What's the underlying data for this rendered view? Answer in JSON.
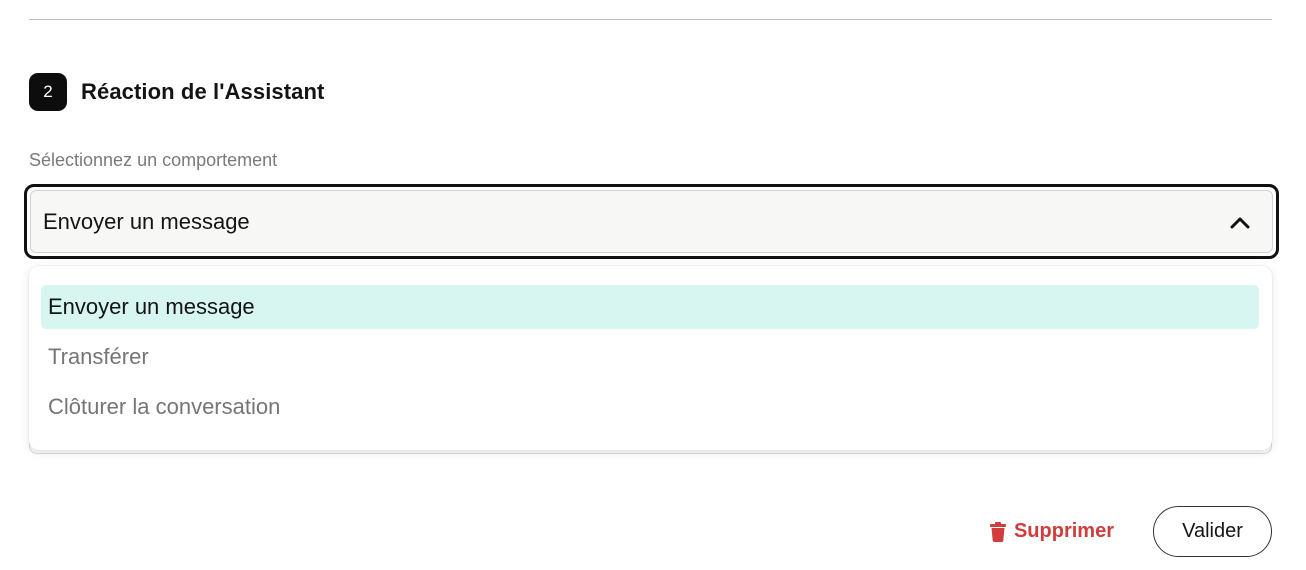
{
  "step": {
    "number": "2",
    "title": "Réaction de l'Assistant"
  },
  "behavior_field": {
    "label": "Sélectionnez un comportement",
    "selected_value": "Envoyer un message",
    "expanded": true,
    "options": [
      {
        "label": "Envoyer un message",
        "selected": true
      },
      {
        "label": "Transférer",
        "selected": false
      },
      {
        "label": "Clôturer la conversation",
        "selected": false
      }
    ]
  },
  "actions": {
    "delete_label": "Supprimer",
    "delete_icon": "trash-icon",
    "validate_label": "Valider"
  },
  "colors": {
    "selected_option_bg": "#d8f6f1",
    "delete_text": "#d13d3d",
    "badge_bg": "#0d0d0d"
  }
}
